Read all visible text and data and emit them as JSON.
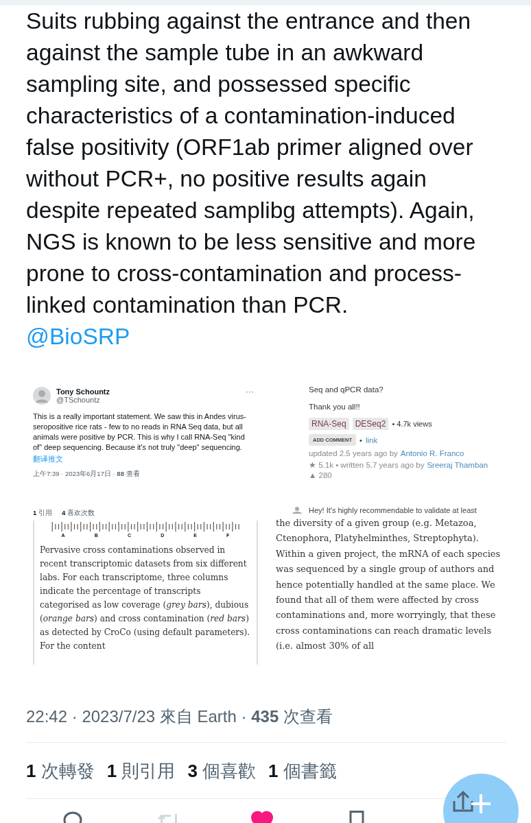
{
  "tweet": {
    "text": "Suits rubbing against the entrance and then against the sample tube in an awkward sampling site, and possessed specific characteristics of a contamination-induced false positivity (ORF1ab primer aligned over without PCR+, no positive results again despite repeated samplibg attempts). Again, NGS is known to be less sensitive and more prone to cross-contamination and process-linked contamination than PCR.",
    "mention": "@BioSRP"
  },
  "images": {
    "quoted_tweet": {
      "name": "Tony Schountz",
      "handle": "@TSchountz",
      "more": "···",
      "body": "This is a really important statement. We saw this in Andes virus-seropositive rice rats - few to no reads in RNA Seq data, but all animals were positive by PCR. This is why I call RNA-Seq \"kind of\" deep sequencing. Because it's not truly \"deep\" sequencing.",
      "translate": "翻译推文",
      "meta": "上午7:39 · 2023年6月17日 · **88** 查看"
    },
    "forum_post": {
      "question_tail": "Seq and qPCR data?",
      "thanks": "Thank you all!!",
      "tags": [
        "RNA-Seq",
        "DESeq2"
      ],
      "views": "• 4.7k views",
      "add_comment": "ADD COMMENT",
      "link_sep": "•",
      "link": "link",
      "updated": "updated 2.5 years ago by",
      "updater": "Antonio R. Franco",
      "written": "★ 5.1k • written 5.7 years ago by",
      "writer": "Sreeraj Thamban",
      "votes": "▲ 280"
    },
    "article_excerpt": {
      "stats": [
        {
          "count": "1",
          "label": "引用"
        },
        {
          "count": "4",
          "label": "喜欢次数"
        }
      ],
      "figure_labels": [
        "A",
        "B",
        "C",
        "D",
        "E",
        "F"
      ],
      "caption": "Pervasive cross contaminations observed in recent transcriptomic datasets from six different labs. For each transcriptome, three columns indicate the percentage of transcripts categorised as low coverage (*grey bars*), dubious (*orange bars*) and cross contamination (*red bars*) as detected by CroCo (using default parameters). For the content"
    },
    "article_text": {
      "comment_tail": "Hey! It's highly recommendable to validate at least",
      "body": "the diversity of a given group (e.g. Metazoa, Ctenophora, Platyhelminthes, Streptophyta). Within a given project, the mRNA of each species was sequenced by a single group of authors and hence potentially handled at the same place. We found that all of them were affected by cross contaminations and, more worryingly, that these cross contaminations can reach dramatic levels (i.e. almost 30% of all"
    }
  },
  "meta": "22:42 · 2023/7/23 來自 Earth · **435** 次查看",
  "stats": [
    {
      "count": "1",
      "label": "次轉發"
    },
    {
      "count": "1",
      "label": "則引用"
    },
    {
      "count": "3",
      "label": "個喜歡"
    },
    {
      "count": "1",
      "label": "個書籤"
    }
  ],
  "actions": [
    {
      "kind": "reply",
      "active": false,
      "disabled": false
    },
    {
      "kind": "retweet",
      "active": false,
      "disabled": true
    },
    {
      "kind": "like",
      "active": true,
      "disabled": false
    },
    {
      "kind": "bookmark",
      "active": false,
      "disabled": false
    }
  ]
}
